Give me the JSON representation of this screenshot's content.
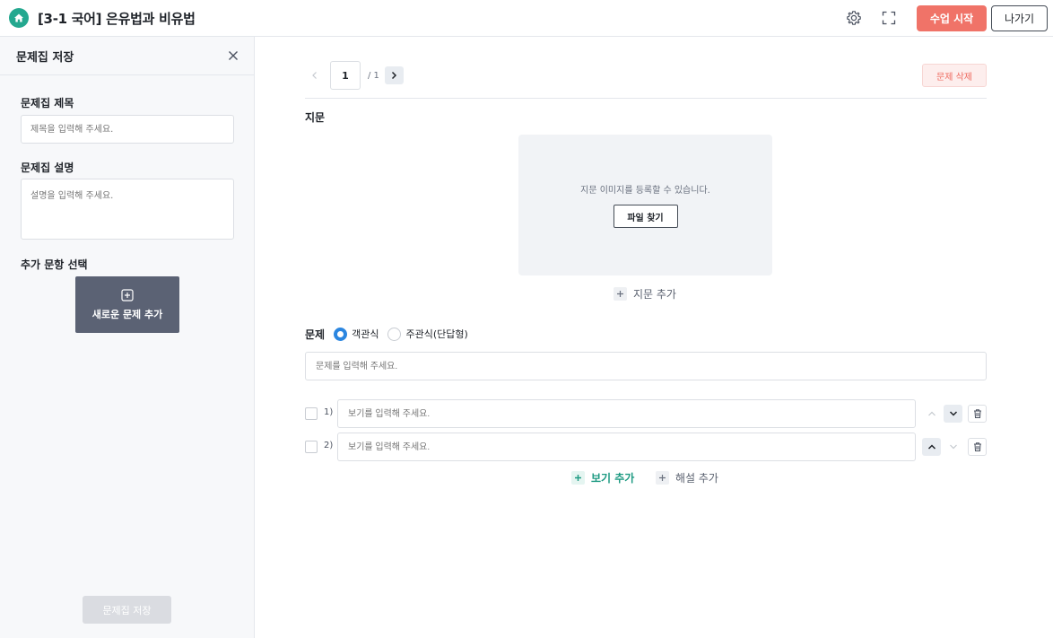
{
  "header": {
    "title": "[3-1 국어] 은유법과 비유법",
    "start_label": "수업 시작",
    "exit_label": "나가기",
    "accent_color": "#f07368",
    "brand_color": "#24a88f"
  },
  "sidebar": {
    "title": "문제집 저장",
    "title_label": "문제집 제목",
    "title_placeholder": "제목을 입력해 주세요.",
    "desc_label": "문제집 설명",
    "desc_placeholder": "설명을 입력해 주세요.",
    "extra_label": "추가 문항 선택",
    "add_new_label": "새로운 문제 추가",
    "save_label": "문제집 저장"
  },
  "main": {
    "pager": {
      "current": "1",
      "total": "/ 1"
    },
    "delete_label": "문제 삭제",
    "passage": {
      "label": "지문",
      "image_hint": "지문 이미지를 등록할 수 있습니다.",
      "file_button": "파일 찾기",
      "add_label": "지문 추가"
    },
    "question": {
      "label": "문제",
      "type_options": [
        "객관식",
        "주관식(단답형)"
      ],
      "selected_type": "객관식",
      "placeholder": "문제를 입력해 주세요."
    },
    "choices": [
      {
        "number": "1)",
        "placeholder": "보기를 입력해 주세요."
      },
      {
        "number": "2)",
        "placeholder": "보기를 입력해 주세요."
      }
    ],
    "add_choice_label": "보기 추가",
    "add_explanation_label": "해설 추가"
  }
}
